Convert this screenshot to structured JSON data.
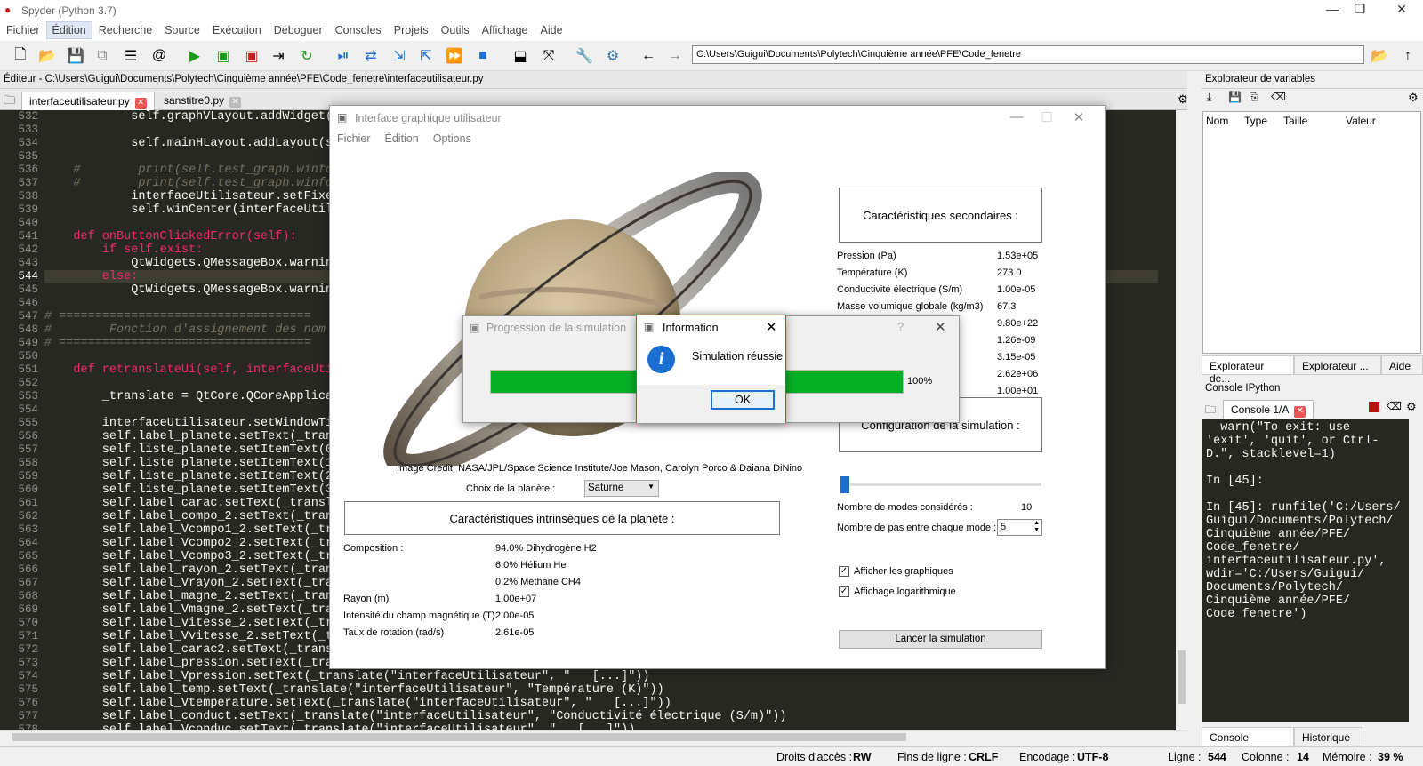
{
  "window": {
    "title": "Spyder (Python 3.7)",
    "min": "—",
    "max": "❐",
    "close": "✕"
  },
  "menu": [
    "Fichier",
    "Édition",
    "Recherche",
    "Source",
    "Exécution",
    "Déboguer",
    "Consoles",
    "Projets",
    "Outils",
    "Affichage",
    "Aide"
  ],
  "toolbar": {
    "path": "C:\\Users\\Guigui\\Documents\\Polytech\\Cinquième année\\PFE\\Code_fenetre"
  },
  "editor": {
    "header": "Éditeur - C:\\Users\\Guigui\\Documents\\Polytech\\Cinquième année\\PFE\\Code_fenetre\\interfaceutilisateur.py",
    "tabs": [
      "interfaceutilisateur.py",
      "sanstitre0.py"
    ],
    "current_line": "544"
  },
  "code_lines": [
    {
      "n": "532",
      "t": "            self.graphVLayout.addWidget(s"
    },
    {
      "n": "533",
      "t": ""
    },
    {
      "n": "534",
      "t": "            self.mainHLayout.addLayout(s"
    },
    {
      "n": "535",
      "t": ""
    },
    {
      "n": "536",
      "t": "    #        print(self.test_graph.winfo"
    },
    {
      "n": "537",
      "t": "    #        print(self.test_graph.winfo"
    },
    {
      "n": "538",
      "t": "            interfaceUtilisateur.setFixe"
    },
    {
      "n": "539",
      "t": "            self.winCenter(interfaceUtil"
    },
    {
      "n": "540",
      "t": ""
    },
    {
      "n": "541",
      "t": "    def onButtonClickedError(self):"
    },
    {
      "n": "542",
      "t": "        if self.exist:"
    },
    {
      "n": "543",
      "t": "            QtWidgets.QMessageBox.warnin"
    },
    {
      "n": "544",
      "t": "        else:"
    },
    {
      "n": "545",
      "t": "            QtWidgets.QMessageBox.warnin"
    },
    {
      "n": "546",
      "t": ""
    },
    {
      "n": "547",
      "t": "# ==================================="
    },
    {
      "n": "548",
      "t": "#        Fonction d'assignement des nom"
    },
    {
      "n": "549",
      "t": "# ==================================="
    },
    {
      "n": "550",
      "t": ""
    },
    {
      "n": "551",
      "t": "    def retranslateUi(self, interfaceUti"
    },
    {
      "n": "552",
      "t": ""
    },
    {
      "n": "553",
      "t": "        _translate = QtCore.QCoreApplica"
    },
    {
      "n": "554",
      "t": ""
    },
    {
      "n": "555",
      "t": "        interfaceUtilisateur.setWindowTi"
    },
    {
      "n": "556",
      "t": "        self.label_planete.setText(_tran"
    },
    {
      "n": "557",
      "t": "        self.liste_planete.setItemText(0"
    },
    {
      "n": "558",
      "t": "        self.liste_planete.setItemText(1"
    },
    {
      "n": "559",
      "t": "        self.liste_planete.setItemText(2"
    },
    {
      "n": "560",
      "t": "        self.liste_planete.setItemText(3"
    },
    {
      "n": "561",
      "t": "        self.label_carac.setText(_transl"
    },
    {
      "n": "562",
      "t": "        self.label_compo_2.setText(_tran"
    },
    {
      "n": "563",
      "t": "        self.label_Vcompo1_2.setText(_tr"
    },
    {
      "n": "564",
      "t": "        self.label_Vcompo2_2.setText(_tr"
    },
    {
      "n": "565",
      "t": "        self.label_Vcompo3_2.setText(_tr"
    },
    {
      "n": "566",
      "t": "        self.label_rayon_2.setText(_tran"
    },
    {
      "n": "567",
      "t": "        self.label_Vrayon_2.setText(_tra"
    },
    {
      "n": "568",
      "t": "        self.label_magne_2.setText(_tran"
    },
    {
      "n": "569",
      "t": "        self.label_Vmagne_2.setText(_tra"
    },
    {
      "n": "570",
      "t": "        self.label_vitesse_2.setText(_tr"
    },
    {
      "n": "571",
      "t": "        self.label_Vvitesse_2.setText(_t"
    },
    {
      "n": "572",
      "t": "        self.label_carac2.setText(_trans"
    },
    {
      "n": "573",
      "t": "        self.label_pression.setText(_tra"
    },
    {
      "n": "574",
      "t": "        self.label_Vpression.setText(_translate(\"interfaceUtilisateur\", \"   [...]\"))"
    },
    {
      "n": "575",
      "t": "        self.label_temp.setText(_translate(\"interfaceUtilisateur\", \"Température (K)\"))"
    },
    {
      "n": "576",
      "t": "        self.label_Vtemperature.setText(_translate(\"interfaceUtilisateur\", \"   [...]\"))"
    },
    {
      "n": "577",
      "t": "        self.label_conduct.setText(_translate(\"interfaceUtilisateur\", \"Conductivité électrique (S/m)\"))"
    },
    {
      "n": "578",
      "t": "        self.label_Vconduc.setText(_translate(\"interfaceUtilisateur\", \"   [...]\"))"
    }
  ],
  "var_explorer": {
    "title": "Explorateur de variables",
    "cols": [
      "Nom",
      "Type",
      "Taille",
      "Valeur"
    ],
    "tabs": [
      "Explorateur de...",
      "Explorateur ...",
      "Aide"
    ]
  },
  "console": {
    "title": "Console IPython",
    "tab": "Console 1/A",
    "text": "  warn(\"To exit: use\n'exit', 'quit', or Ctrl-\nD.\", stacklevel=1)\n\nIn [45]:\n\nIn [45]: runfile('C:/Users/\nGuigui/Documents/Polytech/\nCinquième année/PFE/\nCode_fenetre/\ninterfaceutilisateur.py',\nwdir='C:/Users/Guigui/\nDocuments/Polytech/\nCinquième année/PFE/\nCode_fenetre')",
    "tabs": [
      "Console IPython",
      "Historique"
    ]
  },
  "status": {
    "access_label": "Droits d'accès :",
    "access": "RW",
    "eol_label": "Fins de ligne :",
    "eol": "CRLF",
    "enc_label": "Encodage :",
    "enc": "UTF-8",
    "line_label": "Ligne :",
    "line": "544",
    "col_label": "Colonne :",
    "col": "14",
    "mem_label": "Mémoire :",
    "mem": "39 %"
  },
  "app": {
    "title": "Interface graphique utilisateur",
    "menu": [
      "Fichier",
      "Édition",
      "Options"
    ],
    "credit": "Image Credit: NASA/JPL/Space Science Institute/Joe Mason, Carolyn Porco & Daiana DiNino",
    "planet_label": "Choix de la planète :",
    "planet": "Saturne",
    "intr_title": "Caractéristiques intrinsèques de la planète :",
    "intr": [
      {
        "k": "Composition :",
        "v": "94.0% Dihydrogène H2"
      },
      {
        "k": "",
        "v": "6.0% Hélium He"
      },
      {
        "k": "",
        "v": "0.2% Méthane CH4"
      },
      {
        "k": "Rayon (m)",
        "v": "1.00e+07"
      },
      {
        "k": "Intensité du champ magnétique (T)",
        "v": "2.00e-05"
      },
      {
        "k": "Taux de rotation (rad/s)",
        "v": "2.61e-05"
      }
    ],
    "sec_title": "Caractéristiques secondaires :",
    "sec": [
      {
        "k": "Pression (Pa)",
        "v": "1.53e+05"
      },
      {
        "k": "Température (K)",
        "v": "273.0"
      },
      {
        "k": "Conductivité électrique (S/m)",
        "v": "1.00e-05"
      },
      {
        "k": "Masse volumique globale (kg/m3)",
        "v": "67.3"
      },
      {
        "k": "",
        "v": "9.80e+22"
      },
      {
        "k": "gnétique Rm",
        "v": "1.26e-09"
      },
      {
        "k": "",
        "v": "3.15e-05"
      },
      {
        "k": "",
        "v": "2.62e+06"
      },
      {
        "k": "(m)",
        "v": "1.00e+01"
      }
    ],
    "config_title": "Configuration de la simulation :",
    "modes_label": "Nombre de modes considérés :",
    "modes": "10",
    "steps_label": "Nombre de pas entre chaque mode :",
    "steps": "5",
    "chk1": "Afficher les graphiques",
    "chk2": "Affichage logarithmique",
    "run": "Lancer la simulation"
  },
  "progress": {
    "title": "Progression de la simulation",
    "percent": "100%",
    "value": 1.0
  },
  "info": {
    "title": "Information",
    "message": "Simulation réussie",
    "ok": "OK"
  }
}
